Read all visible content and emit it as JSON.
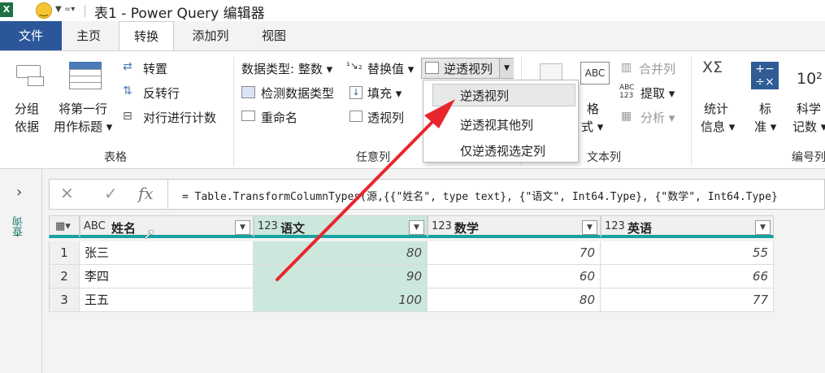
{
  "title": "表1 - Power Query 编辑器",
  "quick_access": {
    "excel_icon": "excel-icon",
    "smile": "smile-icon"
  },
  "tabs": [
    {
      "label": "文件"
    },
    {
      "label": "主页"
    },
    {
      "label": "转换"
    },
    {
      "label": "添加列"
    },
    {
      "label": "视图"
    }
  ],
  "ribbon": {
    "table_group": {
      "label": "表格",
      "group_by": [
        "分组",
        "依据"
      ],
      "first_row": [
        "将第一行",
        "用作标题"
      ],
      "transpose": "转置",
      "reverse": "反转行",
      "count": "对行进行计数"
    },
    "any_column_group": {
      "label": "任意列",
      "data_type": "数据类型: 整数",
      "detect": "检测数据类型",
      "rename": "重命名",
      "replace": "替换值",
      "fill": "填充",
      "pivot": "透视列",
      "unpivot": "逆透视列"
    },
    "text_group": {
      "label": "文本列",
      "format": [
        "格",
        "式"
      ],
      "merge": "合并列",
      "extract": "提取",
      "parse": "分析"
    },
    "number_group": {
      "label": "编号列",
      "stats": [
        "统计",
        "信息"
      ],
      "standard": [
        "标",
        "准"
      ],
      "scientific": [
        "科学",
        "记数"
      ]
    }
  },
  "unpivot_menu": [
    "逆透视列",
    "逆透视其他列",
    "仅逆透视选定列"
  ],
  "nav_label": "查询",
  "formula": "= Table.TransformColumnTypes(源,{{\"姓名\", type text}, {\"语文\", Int64.Type}, {\"数学\", Int64.Type}",
  "formula_icons": {
    "cancel": "close-icon",
    "confirm": "check-icon",
    "fx": "fx"
  },
  "columns": [
    {
      "type": "ABC",
      "label": "姓名"
    },
    {
      "type": "123",
      "label": "语文"
    },
    {
      "type": "123",
      "label": "数学"
    },
    {
      "type": "123",
      "label": "英语"
    }
  ],
  "rows": [
    {
      "n": "1",
      "name": "张三",
      "chinese": "80",
      "math": "70",
      "english": "55"
    },
    {
      "n": "2",
      "name": "李四",
      "chinese": "90",
      "math": "60",
      "english": "66"
    },
    {
      "n": "3",
      "name": "王五",
      "chinese": "100",
      "math": "80",
      "english": "77"
    }
  ],
  "colors": {
    "accent": "#2b579a",
    "header_line": "#17a2a2",
    "selected_col": "#cce8dc",
    "arrow": "#e8262c"
  }
}
